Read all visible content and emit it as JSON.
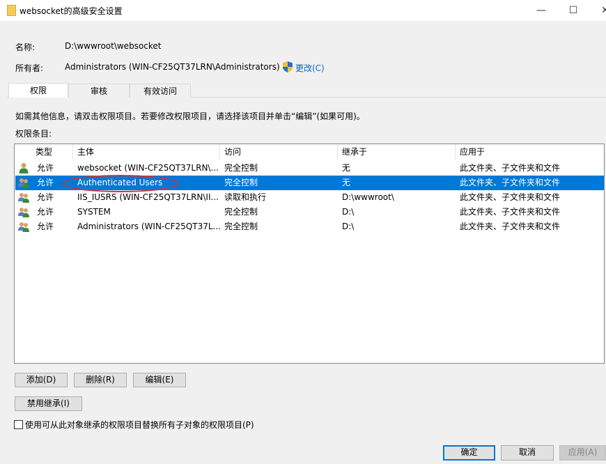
{
  "window": {
    "title": "websocket的高级安全设置",
    "minimize": "—",
    "maximize": "☐",
    "close": "✕"
  },
  "info": {
    "name_label": "名称:",
    "name_value": "D:\\wwwroot\\websocket",
    "owner_label": "所有者:",
    "owner_value": "Administrators (WIN-CF25QT37LRN\\Administrators)",
    "change_link": "更改(C)"
  },
  "tabs": [
    {
      "label": "权限"
    },
    {
      "label": "审核"
    },
    {
      "label": "有效访问"
    }
  ],
  "instructions": "如需其他信息，请双击权限项目。若要修改权限项目，请选择该项目并单击“编辑”(如果可用)。",
  "entries_label": "权限条目:",
  "columns": [
    "类型",
    "主体",
    "访问",
    "继承于",
    "应用于"
  ],
  "rows": [
    {
      "type": "允许",
      "principal": "websocket (WIN-CF25QT37LRN\\...",
      "access": "完全控制",
      "inherited": "无",
      "applies": "此文件夹、子文件夹和文件"
    },
    {
      "type": "允许",
      "principal": "Authenticated Users",
      "access": "完全控制",
      "inherited": "无",
      "applies": "此文件夹、子文件夹和文件"
    },
    {
      "type": "允许",
      "principal": "IIS_IUSRS (WIN-CF25QT37LRN\\II...",
      "access": "读取和执行",
      "inherited": "D:\\wwwroot\\",
      "applies": "此文件夹、子文件夹和文件"
    },
    {
      "type": "允许",
      "principal": "SYSTEM",
      "access": "完全控制",
      "inherited": "D:\\",
      "applies": "此文件夹、子文件夹和文件"
    },
    {
      "type": "允许",
      "principal": "Administrators (WIN-CF25QT37L...",
      "access": "完全控制",
      "inherited": "D:\\",
      "applies": "此文件夹、子文件夹和文件"
    }
  ],
  "buttons": {
    "add": "添加(D)",
    "remove": "删除(R)",
    "edit": "编辑(E)",
    "disable_inheritance": "禁用继承(I)",
    "ok": "确定",
    "cancel": "取消",
    "apply": "应用(A)"
  },
  "replace_checkbox": "使用可从此对象继承的权限项目替换所有子对象的权限项目(P)",
  "colors": {
    "selection": "#0078d7",
    "annotation": "#d93030",
    "link": "#0066cc"
  }
}
